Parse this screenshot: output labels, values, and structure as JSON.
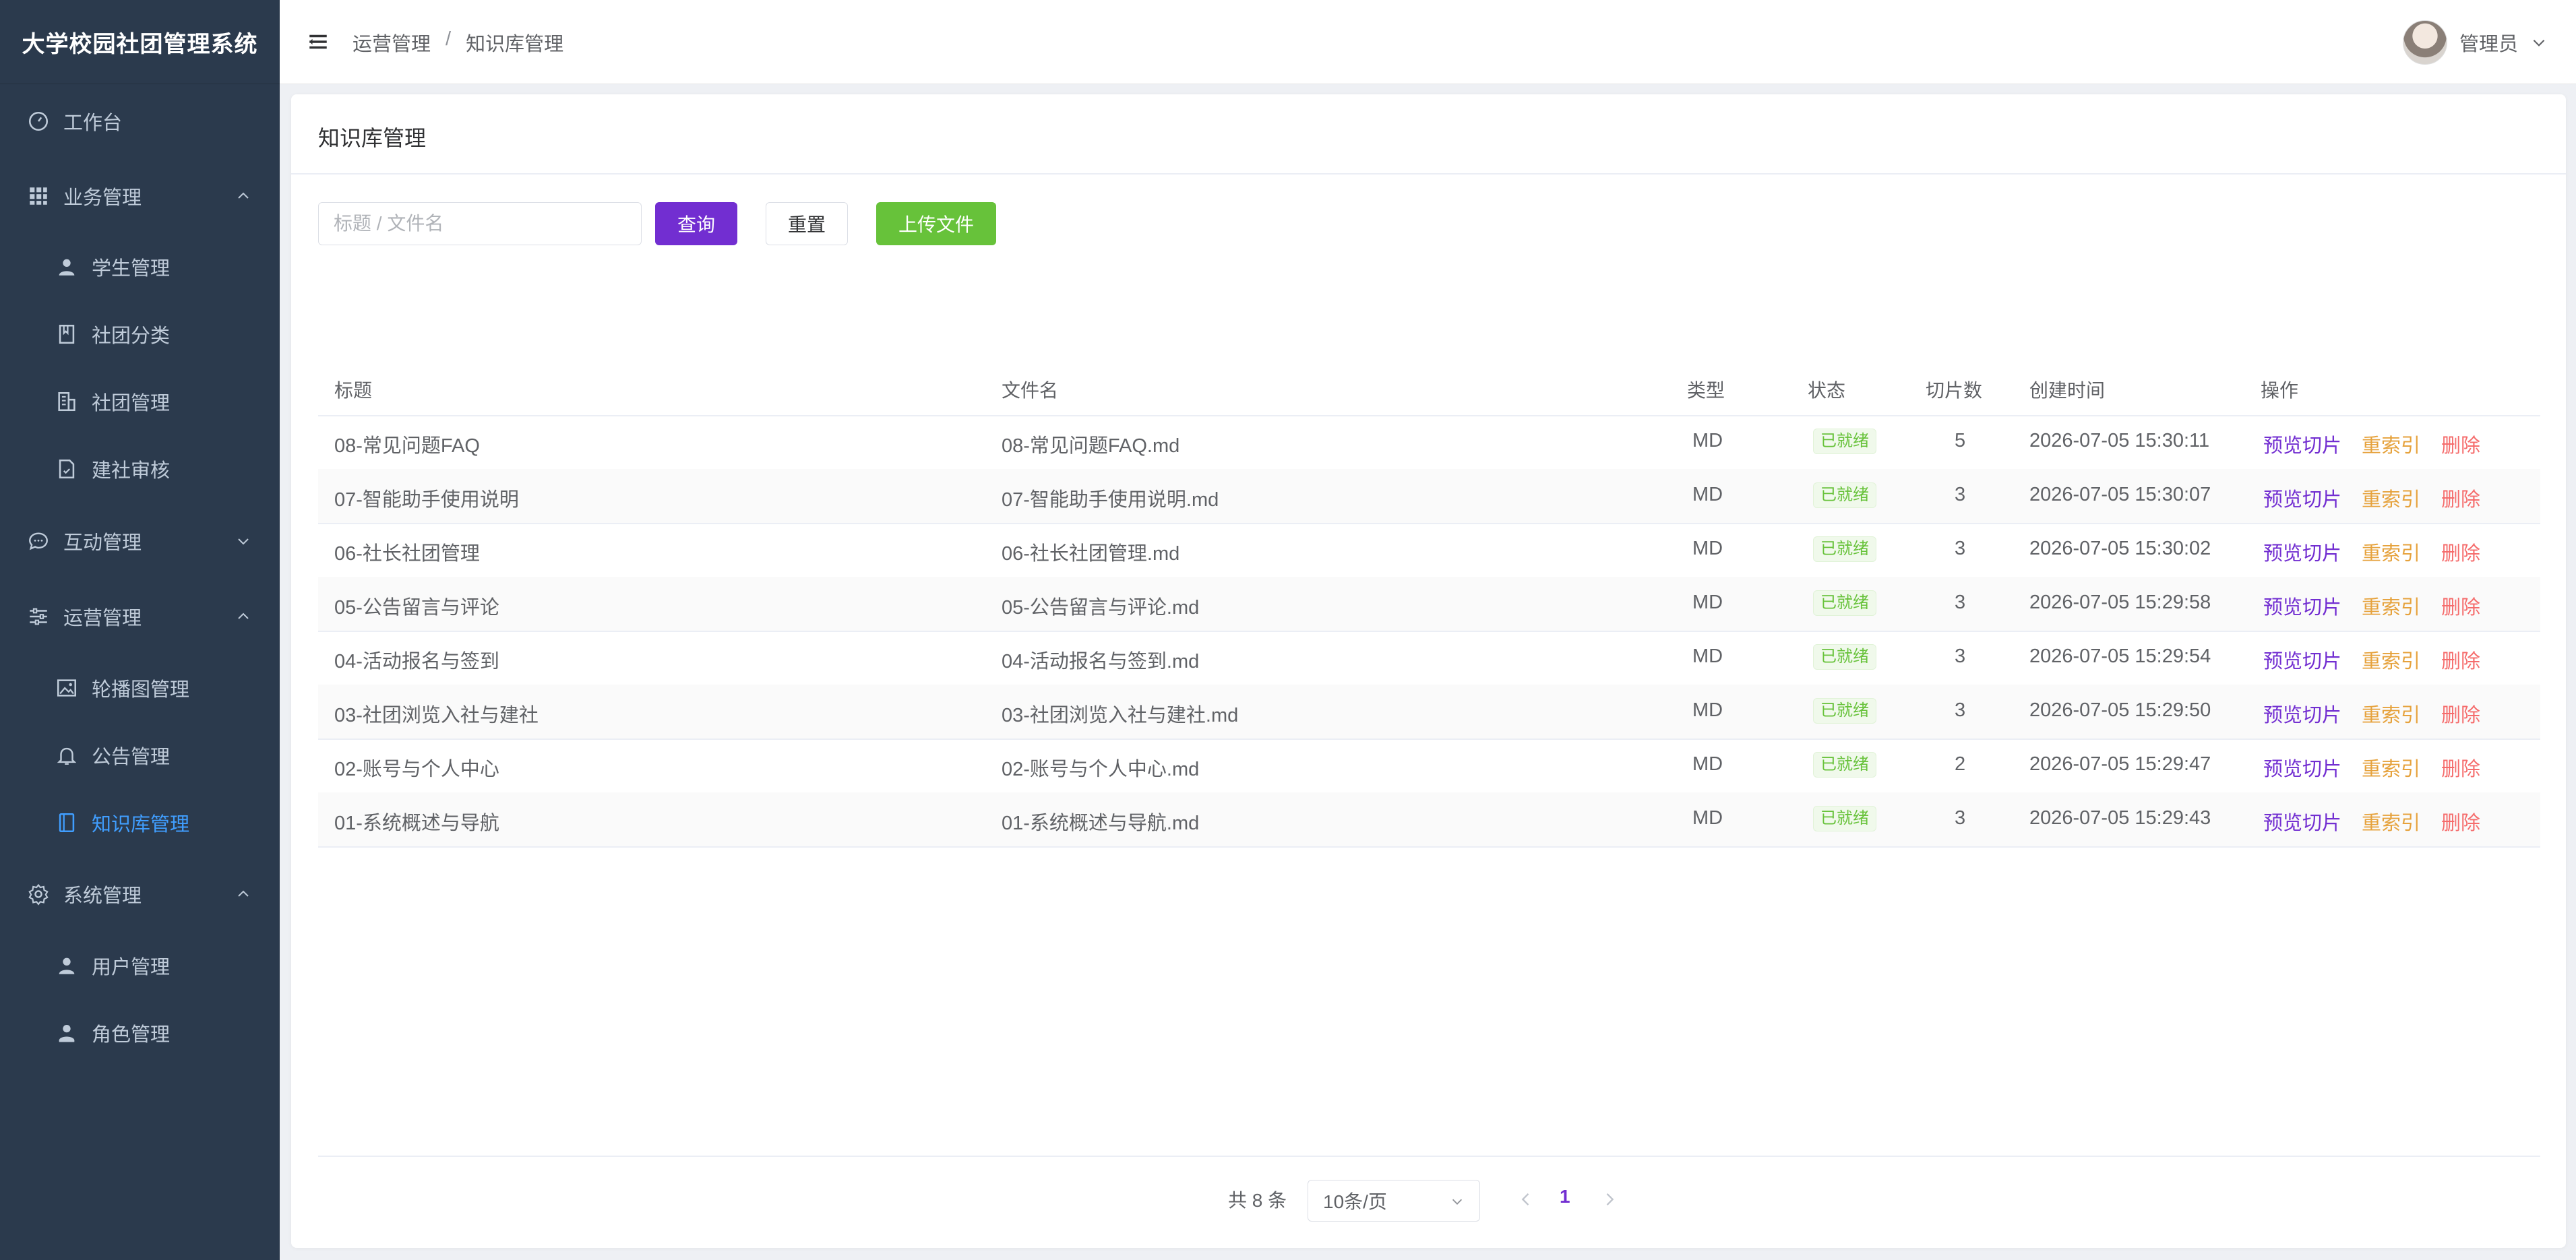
{
  "app": {
    "title": "大学校园社团管理系统"
  },
  "sidebar": {
    "items": [
      {
        "label": "工作台",
        "icon": "dashboard-icon"
      },
      {
        "label": "业务管理",
        "icon": "grid-icon"
      },
      {
        "label": "学生管理",
        "icon": "user-icon"
      },
      {
        "label": "社团分类",
        "icon": "bookmark-icon"
      },
      {
        "label": "社团管理",
        "icon": "building-icon"
      },
      {
        "label": "建社审核",
        "icon": "document-check-icon"
      },
      {
        "label": "互动管理",
        "icon": "chat-icon"
      },
      {
        "label": "运营管理",
        "icon": "sliders-icon"
      },
      {
        "label": "轮播图管理",
        "icon": "image-icon"
      },
      {
        "label": "公告管理",
        "icon": "bell-icon"
      },
      {
        "label": "知识库管理",
        "icon": "book-icon"
      },
      {
        "label": "系统管理",
        "icon": "gear-icon"
      },
      {
        "label": "用户管理",
        "icon": "user-icon"
      },
      {
        "label": "角色管理",
        "icon": "user-badge-icon"
      }
    ],
    "active_color": "#409eff",
    "bg_color": "#2b3a4d"
  },
  "header": {
    "breadcrumb": [
      "运营管理",
      "知识库管理"
    ],
    "breadcrumb_sep": "/",
    "user_name": "管理员"
  },
  "main": {
    "title": "知识库管理",
    "search": {
      "placeholder": "标题 / 文件名",
      "value": ""
    },
    "buttons": {
      "query": "查询",
      "reset": "重置",
      "upload": "上传文件"
    },
    "columns": [
      "标题",
      "文件名",
      "类型",
      "状态",
      "切片数",
      "创建时间",
      "操作"
    ],
    "actions": {
      "preview": "预览切片",
      "reindex": "重索引",
      "delete": "删除"
    },
    "rows": [
      {
        "title": "08-常见问题FAQ",
        "file": "08-常见问题FAQ.md",
        "type": "MD",
        "status": "已就绪",
        "chunks": "5",
        "created": "2026-07-05 15:30:11"
      },
      {
        "title": "07-智能助手使用说明",
        "file": "07-智能助手使用说明.md",
        "type": "MD",
        "status": "已就绪",
        "chunks": "3",
        "created": "2026-07-05 15:30:07"
      },
      {
        "title": "06-社长社团管理",
        "file": "06-社长社团管理.md",
        "type": "MD",
        "status": "已就绪",
        "chunks": "3",
        "created": "2026-07-05 15:30:02"
      },
      {
        "title": "05-公告留言与评论",
        "file": "05-公告留言与评论.md",
        "type": "MD",
        "status": "已就绪",
        "chunks": "3",
        "created": "2026-07-05 15:29:58"
      },
      {
        "title": "04-活动报名与签到",
        "file": "04-活动报名与签到.md",
        "type": "MD",
        "status": "已就绪",
        "chunks": "3",
        "created": "2026-07-05 15:29:54"
      },
      {
        "title": "03-社团浏览入社与建社",
        "file": "03-社团浏览入社与建社.md",
        "type": "MD",
        "status": "已就绪",
        "chunks": "3",
        "created": "2026-07-05 15:29:50"
      },
      {
        "title": "02-账号与个人中心",
        "file": "02-账号与个人中心.md",
        "type": "MD",
        "status": "已就绪",
        "chunks": "2",
        "created": "2026-07-05 15:29:47"
      },
      {
        "title": "01-系统概述与导航",
        "file": "01-系统概述与导航.md",
        "type": "MD",
        "status": "已就绪",
        "chunks": "3",
        "created": "2026-07-05 15:29:43"
      }
    ],
    "pagination": {
      "total": "共 8 条",
      "page_size": "10条/页",
      "current_page": "1"
    },
    "colors": {
      "primary": "#722ed1",
      "success": "#67c23a",
      "warning": "#e6a23c",
      "danger": "#f56c6c"
    }
  }
}
